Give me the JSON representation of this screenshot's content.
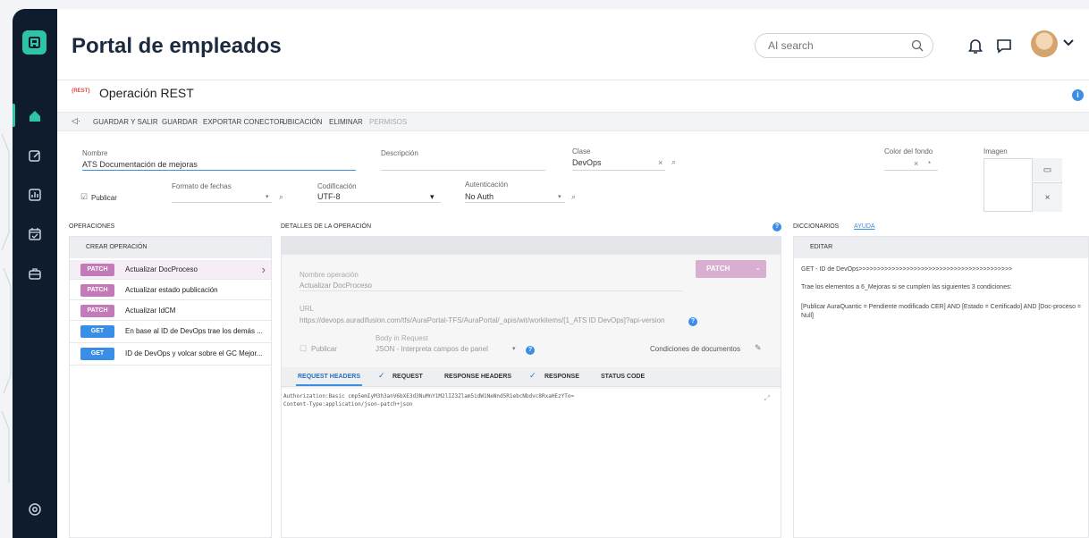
{
  "app": {
    "title": "Portal de empleados",
    "search_placeholder": "AI search"
  },
  "icons": {
    "logo": "aura-logo-icon",
    "home": "home-icon",
    "edit": "edit-icon",
    "chart": "chart-icon",
    "calendar": "calendar-icon",
    "briefcase": "briefcase-icon",
    "settings": "settings-icon",
    "bell": "bell-icon",
    "chat": "chat-icon",
    "search": "search-icon"
  },
  "page": {
    "tag": "{REST}",
    "title": "Operación REST"
  },
  "toolbar": {
    "items": [
      "GUARDAR Y SALIR",
      "GUARDAR",
      "EXPORTAR CONECTOR",
      "UBICACIÓN",
      "ELIMINAR",
      "PERMISOS"
    ]
  },
  "form": {
    "nombre_label": "Nombre",
    "nombre_value": "ATS Documentación de mejoras",
    "descripcion_label": "Descripción",
    "clase_label": "Clase",
    "clase_value": "DevOps",
    "color_label": "Color del fondo",
    "imagen_label": "Imagen",
    "publicar_label": "Publicar",
    "formato_label": "Formato de fechas",
    "codificacion_label": "Codificación",
    "codificacion_value": "UTF-8",
    "autenticacion_label": "Autenticación",
    "autenticacion_value": "No Auth"
  },
  "operaciones": {
    "title": "OPERACIONES",
    "create_label": "CREAR OPERACIÓN",
    "items": [
      {
        "method": "PATCH",
        "label": "Actualizar DocProceso"
      },
      {
        "method": "PATCH",
        "label": "Actualizar estado publicación"
      },
      {
        "method": "PATCH",
        "label": "Actualizar IdCM"
      },
      {
        "method": "GET",
        "label": "En base al ID de DevOps trae los demás ..."
      },
      {
        "method": "GET",
        "label": "ID de DevOps y volcar sobre el GC Mejor..."
      }
    ]
  },
  "detalles": {
    "title": "DETALLES DE LA OPERACIÓN",
    "nombre_op_label": "Nombre operación",
    "nombre_op_value": "Actualizar DocProceso",
    "method": "PATCH",
    "url_label": "URL",
    "url_value": "https://devops.auradifusion.com/tfs/AuraPortal-TFS/AuraPortal/_apis/wit/workitems/[1_ATS ID DevOps]?api-version",
    "publicar_label": "Publicar",
    "body_label": "Body in Request",
    "body_value": "JSON - Interpreta campos de panel",
    "condiciones_label": "Condiciones de documentos",
    "tabs": [
      "REQUEST HEADERS",
      "REQUEST",
      "RESPONSE HEADERS",
      "RESPONSE",
      "STATUS CODE"
    ],
    "code_lines": [
      "Authorization:Basic cmp5emIyM3h3anV6bXE3d3NuMnY1M2lIZ3Zlam5idW1NeNnd5R1ebcNbdvc8RxaHEzYTo=",
      "Content-Type:application/json-patch+json"
    ]
  },
  "diccionarios": {
    "tab1": "DICCIONARIOS",
    "tab2": "AYUDA",
    "editar": "EDITAR",
    "line1": "GET - ID de DevOps>>>>>>>>>>>>>>>>>>>>>>>>>>>>>>>>>>>>>>>>>>",
    "line2": "Trae los elementos a 6_Mejoras si se cumplen las siguientes 3 condiciones:",
    "line3": "[Publicar AuraQuantic = Pendiente modificado CER] AND [Estado = Certificado] AND [Doc-proceso = Null]"
  },
  "colors": {
    "sidebar": "#0f1c2e",
    "accent": "#2ec4a6",
    "patch": "#c47ab8",
    "get": "#3a8ee6"
  }
}
